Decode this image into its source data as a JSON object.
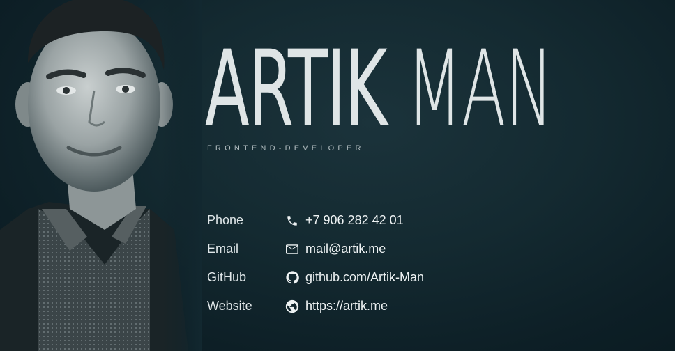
{
  "profile": {
    "first_name": "ARTIK",
    "last_name": "MAN",
    "role": "FRONTEND-DEVELOPER"
  },
  "contacts": [
    {
      "label": "Phone",
      "icon": "phone-icon",
      "value": "+7 906 282 42 01"
    },
    {
      "label": "Email",
      "icon": "mail-icon",
      "value": "mail@artik.me"
    },
    {
      "label": "GitHub",
      "icon": "github-icon",
      "value": "github.com/Artik-Man"
    },
    {
      "label": "Website",
      "icon": "globe-icon",
      "value": "https://artik.me"
    }
  ],
  "colors": {
    "background": "#142a31",
    "text": "#e6ebec",
    "muted": "#b7c2c5"
  }
}
